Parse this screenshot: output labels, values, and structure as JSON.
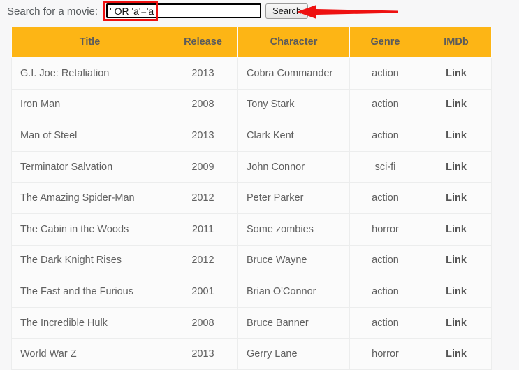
{
  "search": {
    "label": "Search for a movie:",
    "input_value": "' OR 'a'='a",
    "input_placeholder": "",
    "button_label": "Search"
  },
  "annotations": {
    "highlight_target": "search-input",
    "arrow_target": "search-button",
    "color": "#ee1111"
  },
  "table": {
    "columns": [
      "Title",
      "Release",
      "Character",
      "Genre",
      "IMDb"
    ],
    "header_color": "#FDB515",
    "rows": [
      {
        "title": "G.I. Joe: Retaliation",
        "release": "2013",
        "character": "Cobra Commander",
        "genre": "action",
        "imdb": "Link"
      },
      {
        "title": "Iron Man",
        "release": "2008",
        "character": "Tony Stark",
        "genre": "action",
        "imdb": "Link"
      },
      {
        "title": "Man of Steel",
        "release": "2013",
        "character": "Clark Kent",
        "genre": "action",
        "imdb": "Link"
      },
      {
        "title": "Terminator Salvation",
        "release": "2009",
        "character": "John Connor",
        "genre": "sci-fi",
        "imdb": "Link"
      },
      {
        "title": "The Amazing Spider-Man",
        "release": "2012",
        "character": "Peter Parker",
        "genre": "action",
        "imdb": "Link"
      },
      {
        "title": "The Cabin in the Woods",
        "release": "2011",
        "character": "Some zombies",
        "genre": "horror",
        "imdb": "Link"
      },
      {
        "title": "The Dark Knight Rises",
        "release": "2012",
        "character": "Bruce Wayne",
        "genre": "action",
        "imdb": "Link"
      },
      {
        "title": "The Fast and the Furious",
        "release": "2001",
        "character": "Brian O'Connor",
        "genre": "action",
        "imdb": "Link"
      },
      {
        "title": "The Incredible Hulk",
        "release": "2008",
        "character": "Bruce Banner",
        "genre": "action",
        "imdb": "Link"
      },
      {
        "title": "World War Z",
        "release": "2013",
        "character": "Gerry Lane",
        "genre": "horror",
        "imdb": "Link"
      }
    ]
  }
}
